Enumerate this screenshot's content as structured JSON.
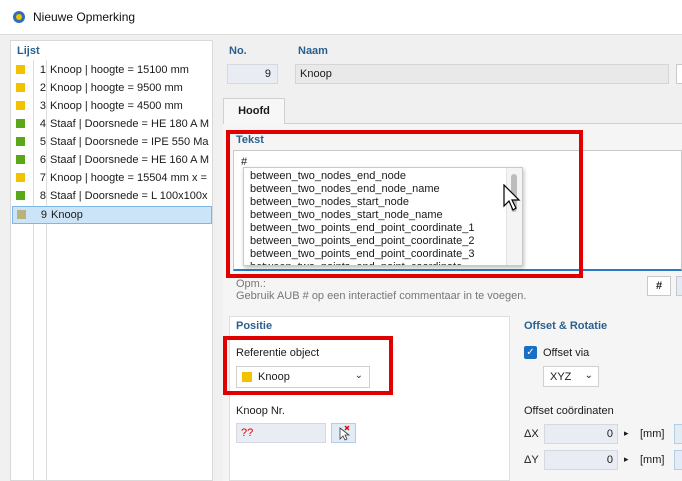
{
  "window": {
    "title": "Nieuwe Opmerking"
  },
  "list": {
    "header": "Lijst",
    "items": [
      {
        "num": "1",
        "label": "Knoop | hoogte = 15100 mm",
        "color": "#f2c200"
      },
      {
        "num": "2",
        "label": "Knoop | hoogte = 9500 mm",
        "color": "#f2c200"
      },
      {
        "num": "3",
        "label": "Knoop | hoogte = 4500 mm",
        "color": "#f2c200"
      },
      {
        "num": "4",
        "label": "Staaf | Doorsnede = HE 180 A M",
        "color": "#5aa817"
      },
      {
        "num": "5",
        "label": "Staaf | Doorsnede = IPE 550 Ma",
        "color": "#5aa817"
      },
      {
        "num": "6",
        "label": "Staaf | Doorsnede = HE 160 A M",
        "color": "#5aa817"
      },
      {
        "num": "7",
        "label": "Knoop | hoogte = 15504 mm x =",
        "color": "#f2c200"
      },
      {
        "num": "8",
        "label": "Staaf | Doorsnede = L 100x100x",
        "color": "#5aa817"
      },
      {
        "num": "9",
        "label": "Knoop",
        "color": "#b9b27a",
        "selected": true
      }
    ]
  },
  "fields": {
    "no_label": "No.",
    "no_value": "9",
    "naam_label": "Naam",
    "naam_value": "Knoop"
  },
  "tabs": [
    {
      "label": "Hoofd",
      "active": true
    }
  ],
  "tekst": {
    "label": "Tekst",
    "value": "#",
    "autocomplete": [
      "between_two_nodes_end_node",
      "between_two_nodes_end_node_name",
      "between_two_nodes_start_node",
      "between_two_nodes_start_node_name",
      "between_two_points_end_point_coordinate_1",
      "between_two_points_end_point_coordinate_2",
      "between_two_points_end_point_coordinate_3",
      "between_two_points_end_point_coordinate"
    ]
  },
  "opm": {
    "label": "Opm.:",
    "text": "Gebruik AUB # op een interactief commentaar in te voegen.",
    "hash_button": "#"
  },
  "positie": {
    "header": "Positie",
    "ref_label": "Referentie object",
    "ref_value": "Knoop",
    "ref_color": "#f2c200",
    "knoop_nr_label": "Knoop Nr.",
    "knoop_nr_value": "??"
  },
  "offset": {
    "header": "Offset & Rotatie",
    "via_label": "Offset via",
    "via_checked": true,
    "via_value": "XYZ",
    "coords_label": "Offset coördinaten",
    "coords": [
      {
        "label": "ΔX",
        "value": "0",
        "unit": "[mm]"
      },
      {
        "label": "ΔY",
        "value": "0",
        "unit": "[mm]"
      }
    ]
  },
  "colors": {
    "highlight": "#e00000",
    "accent": "#1a6fc4",
    "header_text": "#2b5f8f"
  }
}
